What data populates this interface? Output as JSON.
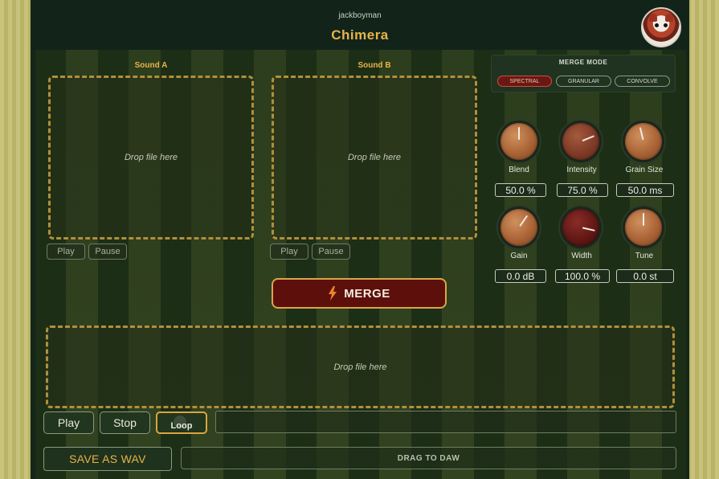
{
  "header": {
    "vendor": "jackboyman",
    "title": "Chimera"
  },
  "sound_a": {
    "label": "Sound A",
    "drop_text": "Drop file here",
    "play_label": "Play",
    "pause_label": "Pause"
  },
  "sound_b": {
    "label": "Sound B",
    "drop_text": "Drop file here",
    "play_label": "Play",
    "pause_label": "Pause"
  },
  "merge_mode": {
    "title": "MERGE MODE",
    "options": [
      "SPECTRAL",
      "GRANULAR",
      "CONVOLVE"
    ],
    "selected": "SPECTRAL"
  },
  "knobs": [
    {
      "label": "Blend",
      "value": "50.0 %",
      "level": 0.5,
      "style": "light"
    },
    {
      "label": "Intensity",
      "value": "75.0 %",
      "level": 0.75,
      "style": "mid"
    },
    {
      "label": "Grain Size",
      "value": "50.0 ms",
      "level": 0.45,
      "style": "light"
    },
    {
      "label": "Gain",
      "value": "0.0 dB",
      "level": 0.63,
      "style": "light"
    },
    {
      "label": "Width",
      "value": "100.0 %",
      "level": 0.88,
      "style": "dark"
    },
    {
      "label": "Tune",
      "value": "0.0 st",
      "level": 0.5,
      "style": "light"
    }
  ],
  "merge_button": {
    "label": "MERGE",
    "icon": "lightning-bolt-icon"
  },
  "output": {
    "drop_text": "Drop file here"
  },
  "transport": {
    "play_label": "Play",
    "stop_label": "Stop",
    "loop_label": "Loop"
  },
  "export": {
    "save_label": "SAVE AS WAV",
    "drag_label": "DRAG TO DAW"
  },
  "colors": {
    "accent": "#e8b349",
    "active_mode": "#6a1814",
    "merge_bg": "#5d0f0c"
  }
}
